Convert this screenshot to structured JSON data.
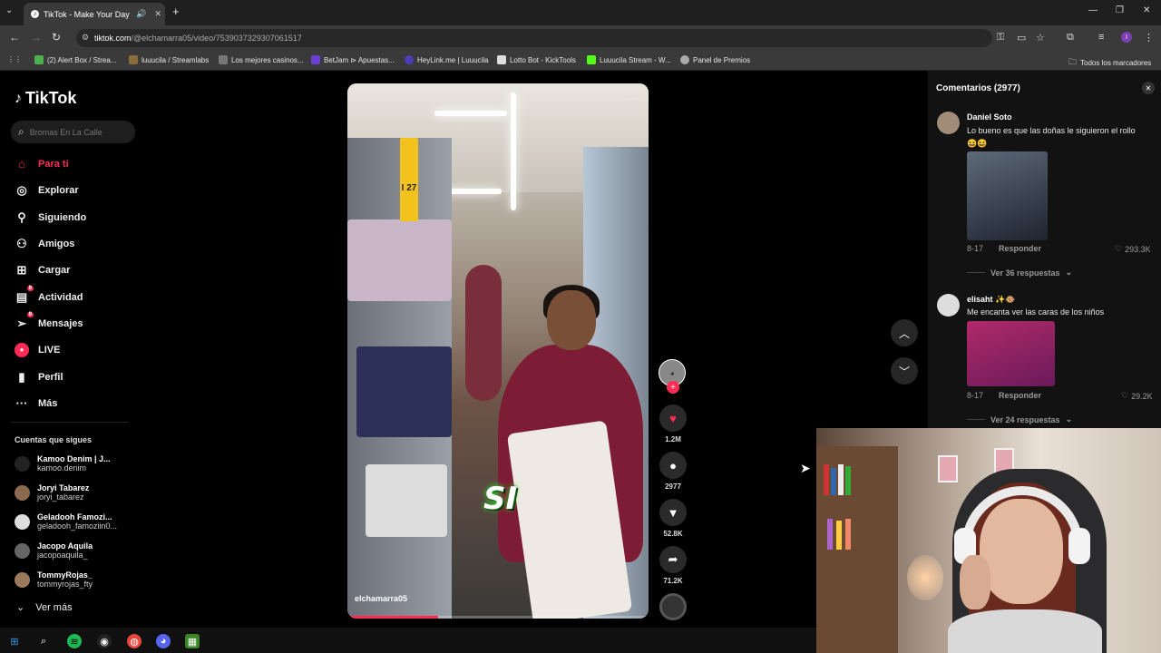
{
  "browser": {
    "tab_title": "TikTok - Make Your Day",
    "url_host": "tiktok.com",
    "url_path": "/@elchamarra05/video/7539037329307061517",
    "bookmarks": [
      {
        "label": "(2) Alert Box / Strea...",
        "color": "#4caf50"
      },
      {
        "label": "luuucila / Streamlabs",
        "color": "#8a6d3b"
      },
      {
        "label": "Los mejores casinos...",
        "color": "#777777"
      },
      {
        "label": "BetJam ⊳ Apuestas...",
        "color": "#6a3fd6"
      },
      {
        "label": "HeyLink.me | Luuucila",
        "color": "#4a3fb8"
      },
      {
        "label": "Lotto Bot - KickTools",
        "color": "#dddddd"
      },
      {
        "label": "Luuucila Stream - W...",
        "color": "#53fc18"
      },
      {
        "label": "Panel de Premios",
        "color": "#aaaaaa"
      }
    ],
    "all_bookmarks": "Todos los marcadores",
    "profile_initial": "I"
  },
  "sidebar": {
    "logo": "TikTok",
    "search_placeholder": "Bromas En La Calle",
    "nav": [
      {
        "label": "Para ti",
        "icon": "home-icon",
        "active": true
      },
      {
        "label": "Explorar",
        "icon": "compass-icon"
      },
      {
        "label": "Siguiendo",
        "icon": "following-icon"
      },
      {
        "label": "Amigos",
        "icon": "friends-icon"
      },
      {
        "label": "Cargar",
        "icon": "upload-icon"
      },
      {
        "label": "Actividad",
        "icon": "activity-icon",
        "badge": "9"
      },
      {
        "label": "Mensajes",
        "icon": "messages-icon",
        "badge": "9"
      },
      {
        "label": "LIVE",
        "icon": "live-icon"
      },
      {
        "label": "Perfil",
        "icon": "profile-icon"
      },
      {
        "label": "Más",
        "icon": "more-icon"
      }
    ],
    "following_title": "Cuentas que sigues",
    "accounts": [
      {
        "name": "Kamoo Denim | J...",
        "handle": "kamoo.denim"
      },
      {
        "name": "Joryi Tabarez",
        "handle": "joryi_tabarez"
      },
      {
        "name": "Geladooh Famozi...",
        "handle": "geladooh_famoziin0..."
      },
      {
        "name": "Jacopo Aquila",
        "handle": "jacopoaquila_"
      },
      {
        "name": "TommyRojas_",
        "handle": "tommyrojas_fty"
      }
    ],
    "see_more": "Ver más"
  },
  "video": {
    "caption": "SI",
    "username": "elchamarra05",
    "aisle_sign": "I 27",
    "progress": 0.3
  },
  "actions": {
    "likes": "1.2M",
    "comments": "2977",
    "saves": "52.8K",
    "shares": "71.2K"
  },
  "comments": {
    "title": "Comentarios (2977)",
    "items": [
      {
        "author": "Daniel Soto",
        "text": "Lo bueno es que las doñas le siguieron el rollo",
        "emoji": "😆😆",
        "date": "8-17",
        "reply": "Responder",
        "likes": "293.3K",
        "view_replies": "Ver 36 respuestas"
      },
      {
        "author": "elisaht",
        "author_suffix": "✨🐵",
        "text": "Me encanta ver las caras de los niños",
        "date": "8-17",
        "reply": "Responder",
        "likes": "29.2K",
        "view_replies": "Ver 24 respuestas"
      }
    ]
  },
  "colors": {
    "accent": "#fe2c55",
    "background": "#000000",
    "panel": "#121212"
  }
}
